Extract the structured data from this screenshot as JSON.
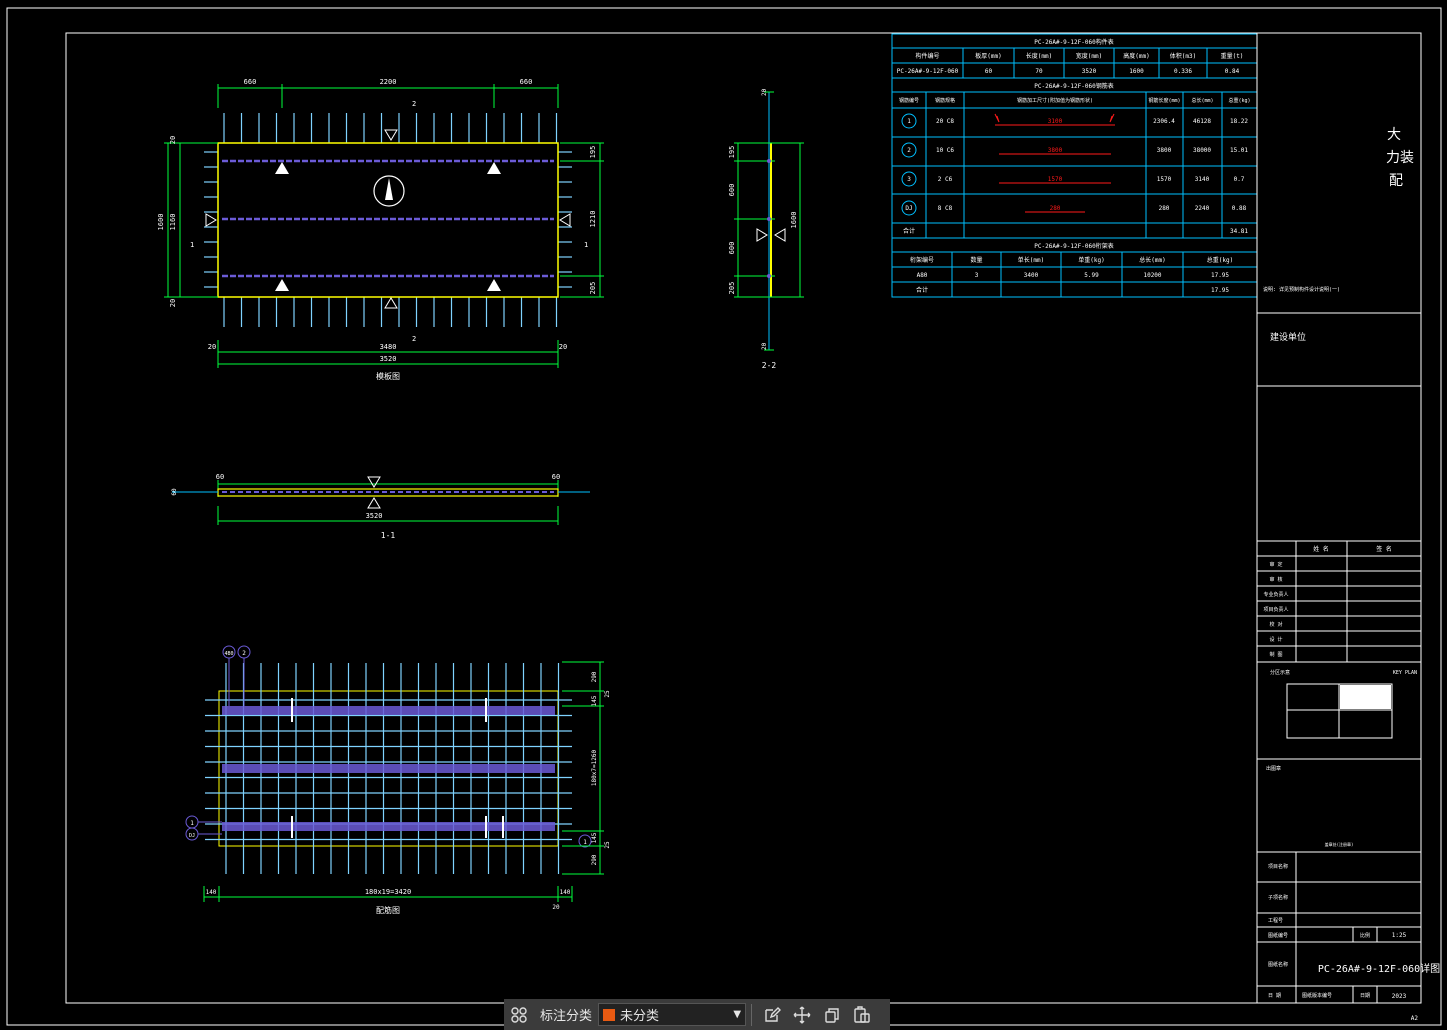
{
  "colors": {
    "frame": "#ffffff",
    "cyan": "#00bfff",
    "lightblue": "#7fd3ff",
    "green": "#00ff3c",
    "yellow": "#ffff00",
    "purple": "#6b5bd6",
    "red": "#ff1a1a",
    "text": "#ffffff"
  },
  "plan": {
    "title": "模板图",
    "top_dims": [
      "660",
      "2200",
      "660"
    ],
    "bottom_dims": [
      "20",
      "3480",
      "20"
    ],
    "total": "3520",
    "left_dims": [
      "20",
      "1160",
      "20"
    ],
    "left_total": "1600",
    "right_dims": [
      "195",
      "1210",
      "205"
    ],
    "cut_label_top": "2",
    "cut_label_bottom": "2",
    "cut_label_left": "1",
    "cut_label_right": "1"
  },
  "section_11": {
    "label": "1-1",
    "dim_left": "60",
    "dim_right": "60",
    "total": "3520",
    "thick": "60"
  },
  "section_22": {
    "label": "2-2",
    "dims": [
      "195",
      "600",
      "600",
      "205"
    ],
    "total": "1600",
    "top": "20",
    "bottom": "20"
  },
  "rebar_plan": {
    "title": "配筋图",
    "bottom_dims": [
      "140",
      "180x19=3420",
      "140"
    ],
    "bottom_right": "20",
    "right_dims": [
      "290",
      "25",
      "145",
      "180x7=1260",
      "145",
      "25",
      "290"
    ],
    "markers": [
      "4B0",
      "2",
      "1",
      "DJ",
      "1"
    ]
  },
  "table1": {
    "title": "PC-26A#-9-12F-060构件表",
    "headers": [
      "构件编号",
      "板厚(mm)",
      "长度(mm)",
      "宽度(mm)",
      "高度(mm)",
      "体积(m3)",
      "重量(t)"
    ],
    "row": [
      "PC-26A#-9-12F-060",
      "60",
      "70",
      "3520",
      "1600",
      "0.336",
      "0.84"
    ]
  },
  "table2": {
    "title": "PC-26A#-9-12F-060钢筋表",
    "headers": [
      "钢筋编号",
      "钢筋规格",
      "钢筋加工尺寸(附加值为钢筋形状)",
      "钢筋长度(mm)",
      "总长(mm)",
      "总重(kg)"
    ],
    "rows": [
      {
        "no": "1",
        "spec": "20 C8",
        "shape": "3100",
        "len": "2306.4",
        "total": "46128",
        "wt": "18.22"
      },
      {
        "no": "2",
        "spec": "10 C6",
        "shape": "3800",
        "len": "3800",
        "total": "38000",
        "wt": "15.01"
      },
      {
        "no": "3",
        "spec": "2 C6",
        "shape": "1570",
        "len": "1570",
        "total": "3140",
        "wt": "0.7"
      },
      {
        "no": "DJ",
        "spec": "8 C8",
        "shape": "280",
        "len": "280",
        "total": "2240",
        "wt": "0.88"
      }
    ],
    "sum_label": "合计",
    "sum_value": "34.81"
  },
  "table3": {
    "title": "PC-26A#-9-12F-060桁架表",
    "headers": [
      "桁架编号",
      "数量",
      "单长(mm)",
      "单重(kg)",
      "总长(mm)",
      "总重(kg)"
    ],
    "row": [
      "A80",
      "3",
      "3400",
      "5.99",
      "10200",
      "17.95"
    ],
    "sum_label": "合计",
    "sum_value": "17.95"
  },
  "title_block": {
    "vertical_text": [
      "大",
      "力装",
      "配"
    ],
    "note": "说明: 详见预制构件设计说明(一)",
    "client": "建设单位",
    "sign_headers": [
      "姓 名",
      "签 名"
    ],
    "sign_rows": [
      "审 定",
      "审 核",
      "专业负责人",
      "项目负责人",
      "校 对",
      "设 计",
      "制 图"
    ],
    "key_plan_label": "KEY PLAN",
    "key_plan_cn": "分区示意",
    "stamp_label": "出图章",
    "stamp_sub": "盖章处(注册章)",
    "project_name": "项目名称",
    "sub_project": "子项名称",
    "project_no": "工程号",
    "drawing_no": "图纸编号",
    "scale_label": "比例",
    "scale": "1:25",
    "drawing_title_label": "图纸名称",
    "drawing_title": "PC-26A#-9-12F-060详图",
    "date_label": "日 期",
    "date_value": "图纸版本编号",
    "date_field": "日期",
    "year": "2023",
    "sheet": "A2"
  },
  "toolbar": {
    "label": "标注分类",
    "selected": "未分类"
  }
}
